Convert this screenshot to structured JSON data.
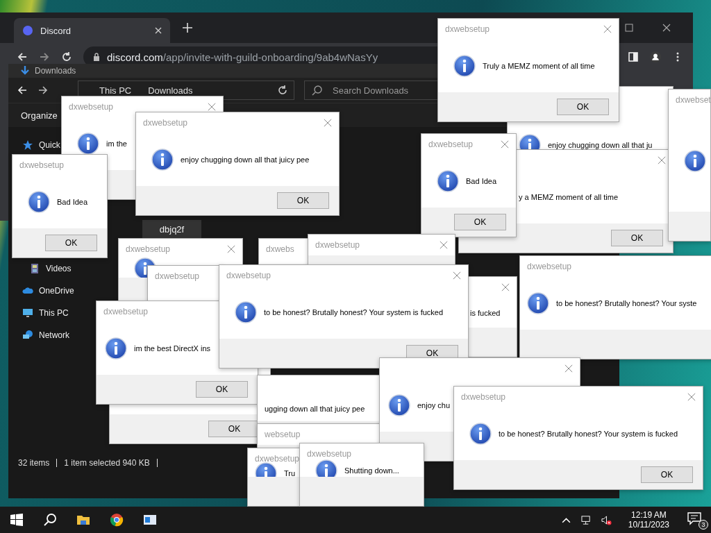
{
  "browser": {
    "tab": {
      "title": "Discord"
    },
    "url": {
      "host": "discord.com",
      "path": "/app/invite-with-guild-onboarding/9ab4wNasYy"
    }
  },
  "explorer": {
    "title": "Downloads",
    "path": [
      "This PC",
      "Downloads"
    ],
    "search": {
      "placeholder": "Search Downloads"
    },
    "toolbar": {
      "label": "Organize"
    },
    "sidebar": {
      "items": [
        {
          "label": "Quick",
          "kind": "star"
        },
        {
          "label": "Videos",
          "kind": "film"
        },
        {
          "label": "OneDrive",
          "kind": "cloud"
        },
        {
          "label": "This PC",
          "kind": "pc"
        },
        {
          "label": "Network",
          "kind": "network"
        }
      ]
    },
    "files": [
      {
        "name": "dbjq2f",
        "selected": true
      }
    ],
    "status_bar": [
      "32 items",
      "1 item selected  940 KB"
    ]
  },
  "dialogs": [
    {
      "message": "enjoy chugging down all that ju",
      "icon": true
    },
    {
      "message": "y a MEMZ moment of all time",
      "ok": "OK",
      "close": true
    },
    {
      "title": "dxwebset",
      "icon": true
    },
    {
      "title": "dxwebsetup",
      "close": true,
      "icon": true,
      "message": "Truly a MEMZ moment of all time",
      "ok": "OK"
    },
    {
      "title": "dxwebsetup",
      "close": true,
      "icon": true,
      "message": "Bad Idea",
      "ok": "OK"
    },
    {
      "title": "dxwebsetup",
      "close": true,
      "icon": true,
      "message": "im the"
    },
    {
      "title": "dxwebsetup",
      "close": true,
      "icon": true,
      "message": "enjoy chugging down all that juicy pee",
      "ok": "OK"
    },
    {
      "title": "dxwebsetup",
      "icon": true,
      "message": "Bad Idea",
      "ok": "OK"
    },
    {
      "title": "dxwebsetup",
      "close": true,
      "icon": true
    },
    {
      "title": "dxwebs"
    },
    {
      "title": "dxwebsetup",
      "close": true
    },
    {
      "title": "dxwebsetup"
    },
    {
      "ok": "OK"
    },
    {
      "title": "dxwebsetup",
      "icon": true,
      "message": "im the best DirectX ins",
      "ok": "OK"
    },
    {
      "title": "dxwebsetup",
      "close": true,
      "icon": true,
      "message": "to be honest? Brutally honest? Your system is fucked",
      "ok": "OK"
    },
    {
      "close": true,
      "message": "is fucked"
    },
    {
      "title": "dxwebsetup",
      "icon": true,
      "message": "to be honest? Brutally honest? Your syste"
    },
    {
      "message": "ugging down all that juicy pee"
    },
    {
      "title": "websetup"
    },
    {
      "close": true,
      "icon": true,
      "message": "enjoy chu"
    },
    {
      "title": "dxwebsetup",
      "icon": true,
      "message": "Tru"
    },
    {
      "title": "dxwebsetup",
      "icon": true,
      "message": "Shutting down..."
    },
    {
      "title": "dxwebsetup",
      "close": true,
      "icon": true,
      "message": "to be honest? Brutally honest? Your system is fucked",
      "ok": "OK"
    }
  ],
  "taskbar": {
    "time": "12:19 AM",
    "date": "10/11/2023",
    "notifications": "3"
  }
}
